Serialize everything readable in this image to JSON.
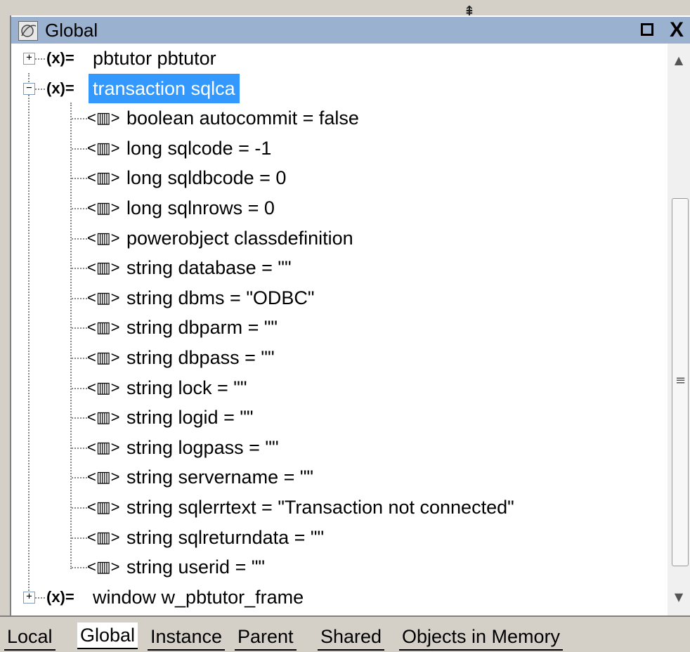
{
  "panel": {
    "title": "Global",
    "restore_label": "",
    "close_label": "X"
  },
  "tree": {
    "nodes": [
      {
        "label": "pbtutor pbtutor",
        "expander": "+",
        "icon": "(x)="
      },
      {
        "label": "transaction sqlca",
        "expander": "−",
        "icon": "(x)=",
        "selected": true
      },
      {
        "label": "boolean autocommit = false",
        "icon": "<▥>"
      },
      {
        "label": "long sqlcode = -1",
        "icon": "<▥>"
      },
      {
        "label": "long sqldbcode = 0",
        "icon": "<▥>"
      },
      {
        "label": "long sqlnrows = 0",
        "icon": "<▥>"
      },
      {
        "label": "powerobject classdefinition",
        "icon": "<▥>"
      },
      {
        "label": "string database = \"\"",
        "icon": "<▥>"
      },
      {
        "label": "string dbms = \"ODBC\"",
        "icon": "<▥>"
      },
      {
        "label": "string dbparm = \"\"",
        "icon": "<▥>"
      },
      {
        "label": "string dbpass = \"\"",
        "icon": "<▥>"
      },
      {
        "label": "string lock = \"\"",
        "icon": "<▥>"
      },
      {
        "label": "string logid = \"\"",
        "icon": "<▥>"
      },
      {
        "label": "string logpass = \"\"",
        "icon": "<▥>"
      },
      {
        "label": "string servername = \"\"",
        "icon": "<▥>"
      },
      {
        "label": "string sqlerrtext = \"Transaction not connected\"",
        "icon": "<▥>"
      },
      {
        "label": "string sqlreturndata = \"\"",
        "icon": "<▥>"
      },
      {
        "label": "string userid = \"\"",
        "icon": "<▥>"
      },
      {
        "label": "window w_pbtutor_frame",
        "expander": "+",
        "icon": "(x)="
      }
    ]
  },
  "tabs": [
    {
      "label": "Local"
    },
    {
      "label": "Global",
      "active": true
    },
    {
      "label": "Instance"
    },
    {
      "label": "Parent"
    },
    {
      "label": "Shared"
    },
    {
      "label": "Objects in Memory"
    }
  ],
  "colors": {
    "titlebar": "#9ab1cf",
    "selection": "#3399ff"
  }
}
